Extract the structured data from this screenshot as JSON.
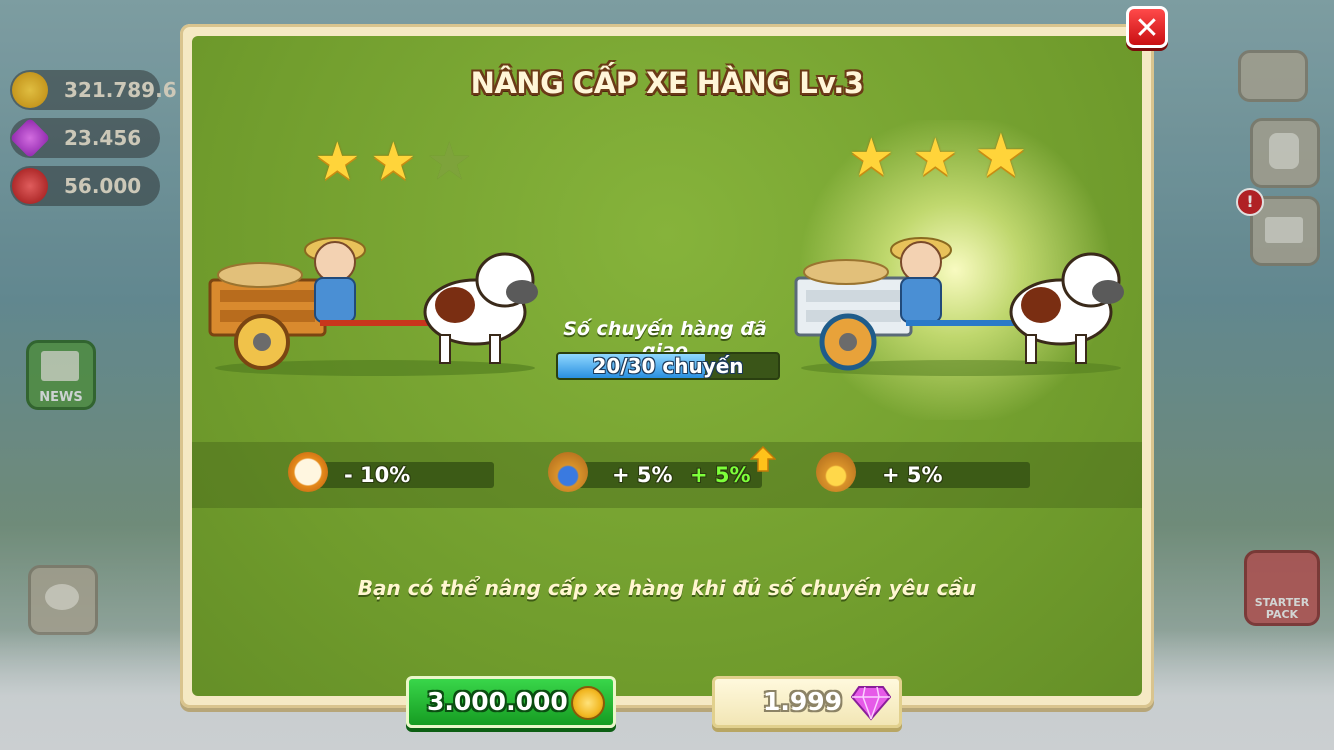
{
  "hud": {
    "coins": "321.789.6",
    "gems": "23.456",
    "hearts": "56.000",
    "news_label": "NEWS",
    "starter_pack_label": "STARTER PACK"
  },
  "dialog": {
    "title": "NÂNG CẤP XE HÀNG Lv.3",
    "close_symbol": "✕",
    "current_stars": {
      "filled": 2,
      "total": 3
    },
    "next_stars": {
      "filled": 3,
      "total": 3
    },
    "progress": {
      "label": "Số chuyến hàng đã giao",
      "text": "20/30 chuyến",
      "fraction": 0.667
    },
    "stats": [
      {
        "icon": "stopwatch-icon",
        "value": "- 10%"
      },
      {
        "icon": "sack-blue-gem-icon",
        "value": "+ 5%",
        "bonus": "+ 5%"
      },
      {
        "icon": "sack-coin-icon",
        "value": "+ 5%"
      }
    ],
    "note": "Bạn có thể nâng cấp xe hàng khi đủ số chuyến yêu cầu",
    "buy_coin": {
      "amount": "3.000.000"
    },
    "buy_gem": {
      "amount": "1.999"
    }
  },
  "colors": {
    "panel_green": "#6f9b2c",
    "frame_cream": "#f5e9c4",
    "coin_button": "#22b32e",
    "close_red": "#d61a1d",
    "progress_blue": "#2a8fe0",
    "bonus_green": "#7dff3a"
  }
}
